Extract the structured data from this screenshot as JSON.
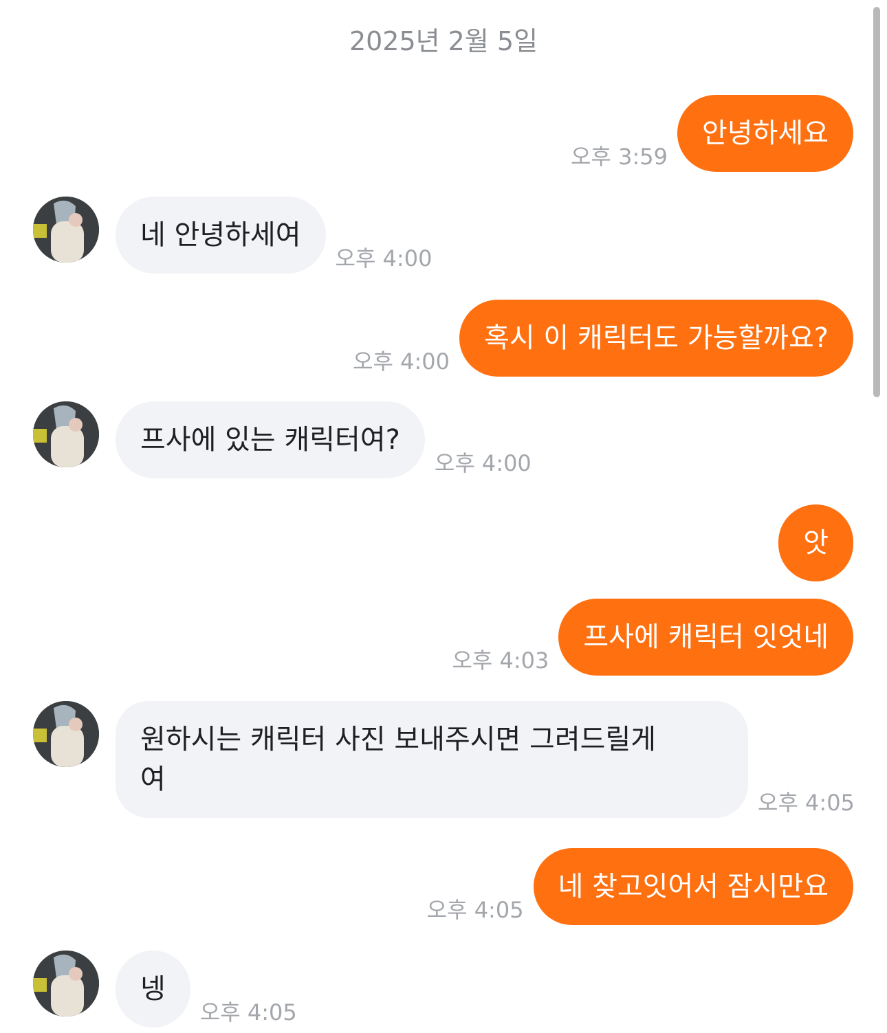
{
  "date_header": "2025년 2월 5일",
  "colors": {
    "sent_bubble": "#ff7010",
    "received_bubble": "#f2f3f6",
    "timestamp": "#a3a6ab"
  },
  "avatar_icon": "plush-doll-avatar",
  "messages": [
    {
      "direction": "sent",
      "text": "안녕하세요",
      "time": "오후 3:59"
    },
    {
      "direction": "received",
      "text": "네 안녕하세여",
      "time": "오후 4:00"
    },
    {
      "direction": "sent",
      "text": "혹시 이 캐릭터도 가능할까요?",
      "time": "오후 4:00"
    },
    {
      "direction": "received",
      "text": "프사에 있는 캐릭터여?",
      "time": "오후 4:00"
    },
    {
      "direction": "sent",
      "text": "앗",
      "time": ""
    },
    {
      "direction": "sent",
      "text": "프사에 캐릭터 잇엇네",
      "time": "오후 4:03"
    },
    {
      "direction": "received",
      "text": "원하시는 캐릭터 사진 보내주시면 그려드릴게\n여",
      "time": "오후 4:05"
    },
    {
      "direction": "sent",
      "text": "네 찾고잇어서 잠시만요",
      "time": "오후 4:05"
    },
    {
      "direction": "received",
      "text": "넹",
      "time": "오후 4:05"
    }
  ]
}
